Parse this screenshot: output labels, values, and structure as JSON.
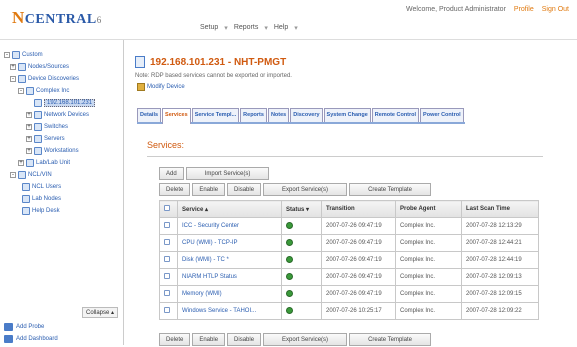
{
  "app": {
    "logo_letter": "N",
    "logo_rest": "CENTRAL",
    "logo_version": "6",
    "menu": [
      "Setup",
      "Reports",
      "Help"
    ],
    "user": "Welcome, Product Administrator",
    "profile_link": "Profile",
    "signout_link": "Sign Out"
  },
  "sidebar": {
    "tree": [
      "Custom",
      "Nodes/Sources",
      "Device Discoveries",
      "Complex Inc",
      "192.168.101.231",
      "Network Devices",
      "Switches",
      "Servers",
      "Workstations",
      "Lab/Lab Unit",
      "NCL/VIN",
      "NCL Users",
      "Lab Nodes",
      "Help Desk"
    ],
    "collapse_label": "Collapse",
    "footer_items": [
      "Add Probe",
      "Add Dashboard"
    ]
  },
  "device": {
    "title": "192.168.101.231 - NHT-PMGT",
    "note": "Note: RDP based services cannot be exported or imported.",
    "edit_label": "Modify Device"
  },
  "tabs": [
    "Details",
    "Services",
    "Service Templ...",
    "Reports",
    "Notes",
    "Discovery",
    "System Change",
    "Remote Control",
    "Power Control"
  ],
  "services": {
    "heading": "Services:",
    "top_buttons": [
      "Add",
      "Import Service(s)"
    ],
    "action_buttons": [
      "Delete",
      "Enable",
      "Disable",
      "Export Service(s)",
      "Create Template"
    ],
    "columns": [
      "",
      "Service",
      "Status",
      "Transition",
      "Probe Agent",
      "Last Scan Time"
    ],
    "rows": [
      {
        "service": "ICC - Security Center",
        "transition": "2007-07-26 09:47:19",
        "agent": "Complex Inc.",
        "last_scan": "2007-07-28 12:13:29"
      },
      {
        "service": "CPU (WMI) - TCP-IP",
        "transition": "2007-07-26 09:47:19",
        "agent": "Complex Inc.",
        "last_scan": "2007-07-28 12:44:21"
      },
      {
        "service": "Disk (WMI) - TC *",
        "transition": "2007-07-26 09:47:19",
        "agent": "Complex Inc.",
        "last_scan": "2007-07-28 12:44:19"
      },
      {
        "service": "NIARM HTLP Status",
        "transition": "2007-07-26 09:47:19",
        "agent": "Complex Inc.",
        "last_scan": "2007-07-28 12:09:13"
      },
      {
        "service": "Memory (WMI)",
        "transition": "2007-07-26 09:47:19",
        "agent": "Complex Inc.",
        "last_scan": "2007-07-28 12:09:15"
      },
      {
        "service": "Windows Service - TAHOI...",
        "transition": "2007-07-26 10:25:17",
        "agent": "Complex Inc.",
        "last_scan": "2007-07-28 12:09:22"
      }
    ]
  }
}
